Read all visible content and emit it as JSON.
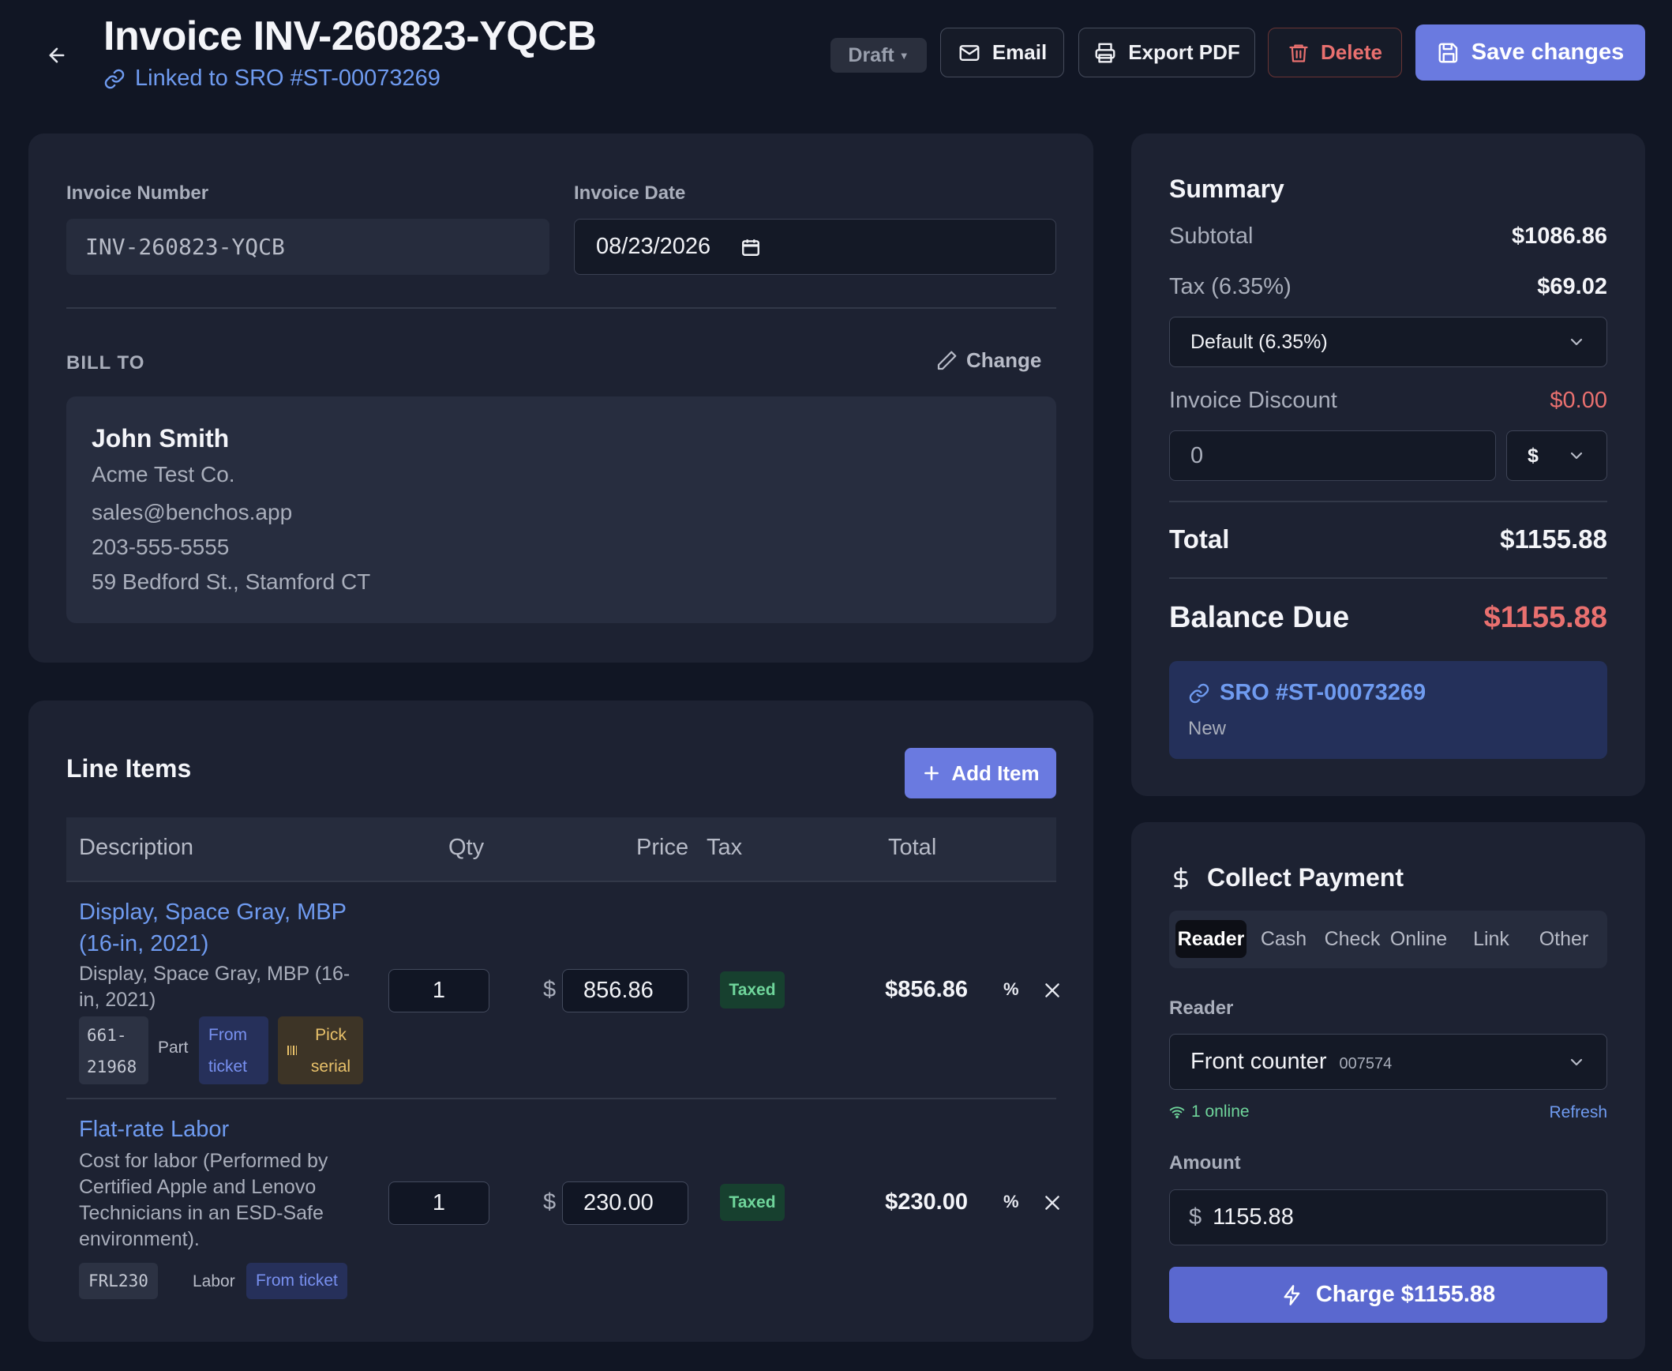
{
  "header": {
    "title": "Invoice INV-260823-YQCB",
    "linked_sro": "Linked to SRO #ST-00073269",
    "status": "Draft",
    "email_label": "Email",
    "export_label": "Export PDF",
    "delete_label": "Delete",
    "save_label": "Save changes"
  },
  "invoice": {
    "number_label": "Invoice Number",
    "number_value": "INV-260823-YQCB",
    "date_label": "Invoice Date",
    "date_value": "08/23/2026"
  },
  "bill_to": {
    "heading": "BILL TO",
    "change_label": "Change",
    "name": "John Smith",
    "company": "Acme Test Co.",
    "email": "sales@benchos.app",
    "phone": "203-555-5555",
    "address": "59 Bedford St., Stamford CT"
  },
  "line_items": {
    "heading": "Line Items",
    "add_label": "Add Item",
    "columns": [
      "Description",
      "Qty",
      "Price",
      "Tax",
      "Total"
    ],
    "currency_symbol": "$",
    "percent_label": "%",
    "items": [
      {
        "title_1": "Display, Space Gray, MBP",
        "title_2": "(16-in, 2021)",
        "desc_1": "Display, Space Gray, MBP (16-",
        "desc_2": "in, 2021)",
        "sku_1": "661-",
        "sku_2": "21968",
        "type": "Part",
        "source_1": "From",
        "source_2": "ticket",
        "serial_1": "Pick",
        "serial_2": "serial",
        "qty": "1",
        "price": "856.86",
        "tax": "Taxed",
        "total": "$856.86"
      },
      {
        "title_1": "Flat-rate Labor",
        "desc_1": "Cost for labor (Performed by",
        "desc_2": "Certified Apple and Lenovo",
        "desc_3": "Technicians in an ESD-Safe",
        "desc_4": "environment).",
        "sku": "FRL230",
        "type": "Labor",
        "source": "From ticket",
        "qty": "1",
        "price": "230.00",
        "tax": "Taxed",
        "total": "$230.00"
      }
    ]
  },
  "summary": {
    "heading": "Summary",
    "subtotal_label": "Subtotal",
    "subtotal_value": "$1086.86",
    "tax_label": "Tax (6.35%)",
    "tax_value": "$69.02",
    "tax_select": "Default (6.35%)",
    "discount_label": "Invoice Discount",
    "discount_value": "$0.00",
    "discount_input": "0",
    "discount_unit": "$",
    "total_label": "Total",
    "total_value": "$1155.88",
    "balance_label": "Balance Due",
    "balance_value": "$1155.88",
    "sro_link": "SRO #ST-00073269",
    "sro_status": "New"
  },
  "payment": {
    "heading": "Collect Payment",
    "tabs": [
      "Reader",
      "Cash",
      "Check",
      "Online",
      "Link",
      "Other"
    ],
    "active_tab": "Reader",
    "reader_label": "Reader",
    "reader_name": "Front counter",
    "reader_id": "007574",
    "online_status": "1 online",
    "refresh_label": "Refresh",
    "amount_label": "Amount",
    "amount_symbol": "$",
    "amount_value": "1155.88",
    "charge_label": "Charge $1155.88"
  },
  "colors": {
    "background": "#111624",
    "card": "#1d2232",
    "accent": "#6a7ae0",
    "link": "#6f9bf0",
    "danger": "#e9706f",
    "success": "#6fd59b"
  }
}
